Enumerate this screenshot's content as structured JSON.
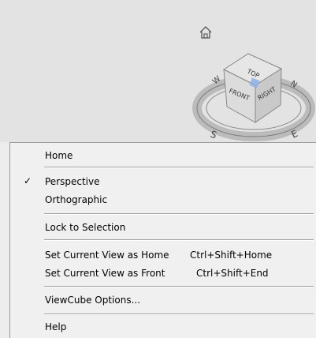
{
  "viewcube": {
    "faces": {
      "top": "TOP",
      "front": "FRONT",
      "right": "RIGHT"
    },
    "compass": {
      "n": "N",
      "w": "W",
      "s": "S",
      "e": "E"
    }
  },
  "menu": {
    "home": "Home",
    "perspective": "Perspective",
    "perspective_checked": "✓",
    "orthographic": "Orthographic",
    "lock_to_selection": "Lock to Selection",
    "set_home": "Set Current View as Home",
    "set_home_shortcut": "Ctrl+Shift+Home",
    "set_front": "Set Current View as Front",
    "set_front_shortcut": "Ctrl+Shift+End",
    "options": "ViewCube Options...",
    "help": "Help"
  },
  "colors": {
    "viewport_bg": "#e3e3e3",
    "menu_bg": "#f0f0f0",
    "separator": "#a0a0a0"
  }
}
